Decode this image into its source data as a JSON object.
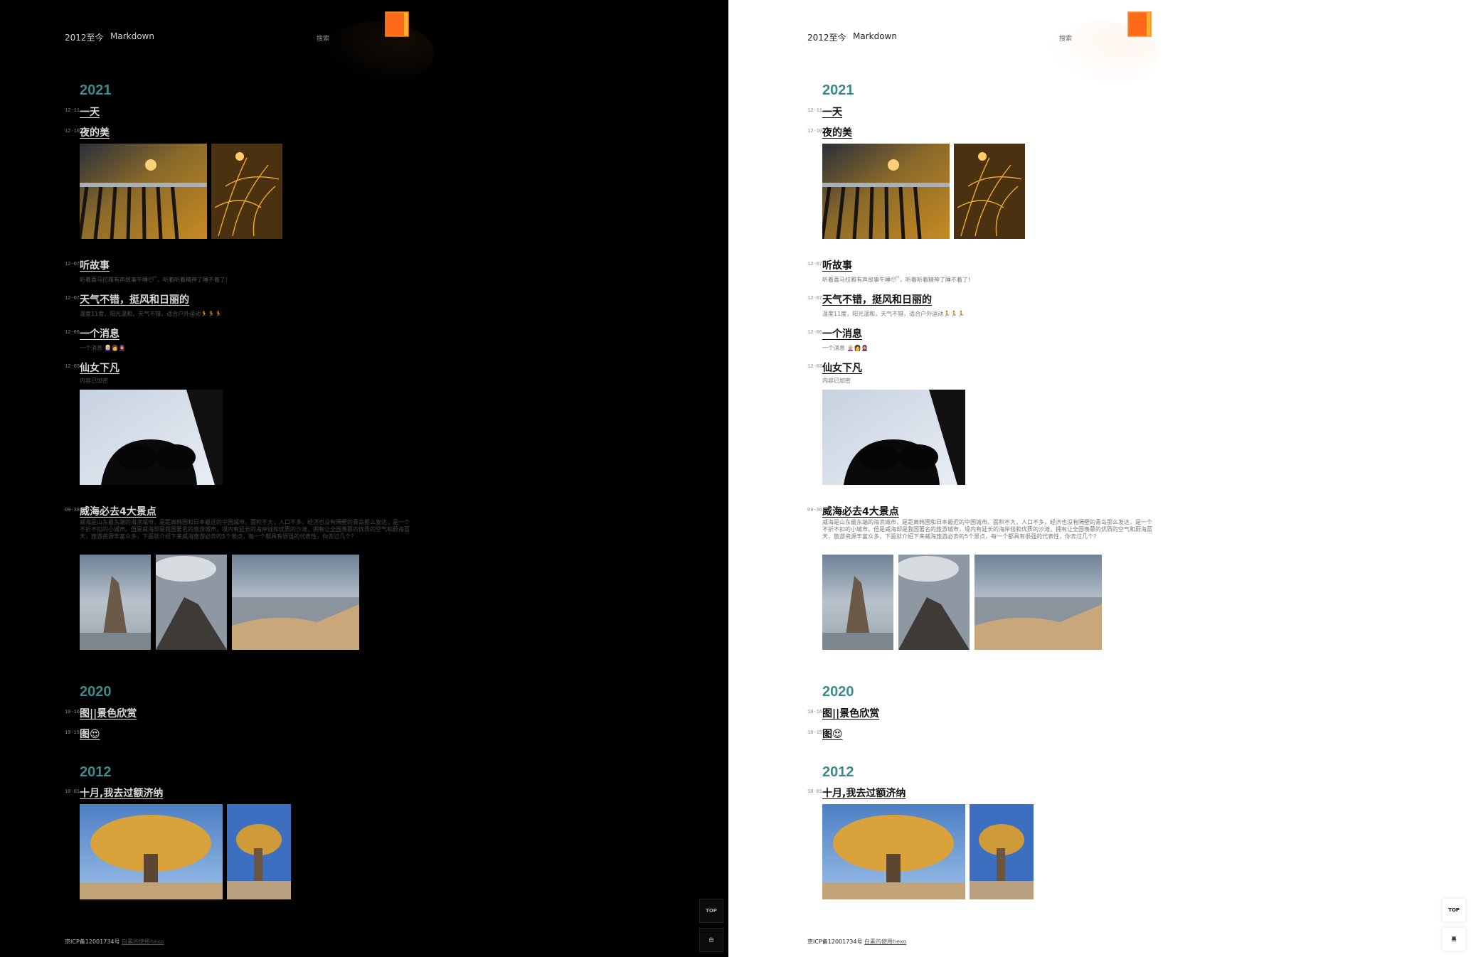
{
  "nav": {
    "brand": "2012至今",
    "markdown": "Markdown",
    "search": "搜索"
  },
  "years": {
    "y2021": "2021",
    "y2020": "2020",
    "y2012": "2012"
  },
  "posts": [
    {
      "date": "12-11",
      "title": "一天"
    },
    {
      "date": "12-10",
      "title": "夜的美"
    },
    {
      "date": "12-07",
      "title": "听故事",
      "desc": "听着喜马拉雅有声故事午睡😴，听着听着精神了睡不着了!"
    },
    {
      "date": "12-07",
      "title": "天气不错，挺风和日丽的",
      "desc": "温度11度，阳光温和，天气不错，适合户外运动🏃🏃🏃"
    },
    {
      "date": "12-06",
      "title": "一个消息",
      "desc": "一个消息 👩‍🦳👩🧕"
    },
    {
      "date": "12-03",
      "title": "仙女下凡",
      "desc": "内容已加密"
    },
    {
      "date": "09-30",
      "title": "威海必去4大景点",
      "desc": "威海是山东最东端的海滨城市，是距离韩国和日本最近的中国城市。面积不大，人口不多，经济也没有隔壁的青岛那么发达，是一个不折不扣的小城市。但是威海却是我国著名的旅游城市，境内有延长的海岸线和优质的沙滩，拥有让全国羡慕的优质的空气和蔚海蓝天，旅游资源丰富众多，下面就介绍下来威海旅游必去的5个景点，每一个都具有很强的代表性，你去过几个?"
    },
    {
      "date": "10-16",
      "title": "图||景色欣赏"
    },
    {
      "date": "10-15",
      "title": "图😍"
    },
    {
      "date": "10-01",
      "title": "十月,我去过额济纳"
    }
  ],
  "footer": {
    "icp": "京ICP备12001734号",
    "link": "白素的使用hexo"
  },
  "buttons": {
    "top": "TOP",
    "dark_toggle": "白",
    "light_toggle": "黑"
  },
  "icons": [
    "logo-icon"
  ]
}
